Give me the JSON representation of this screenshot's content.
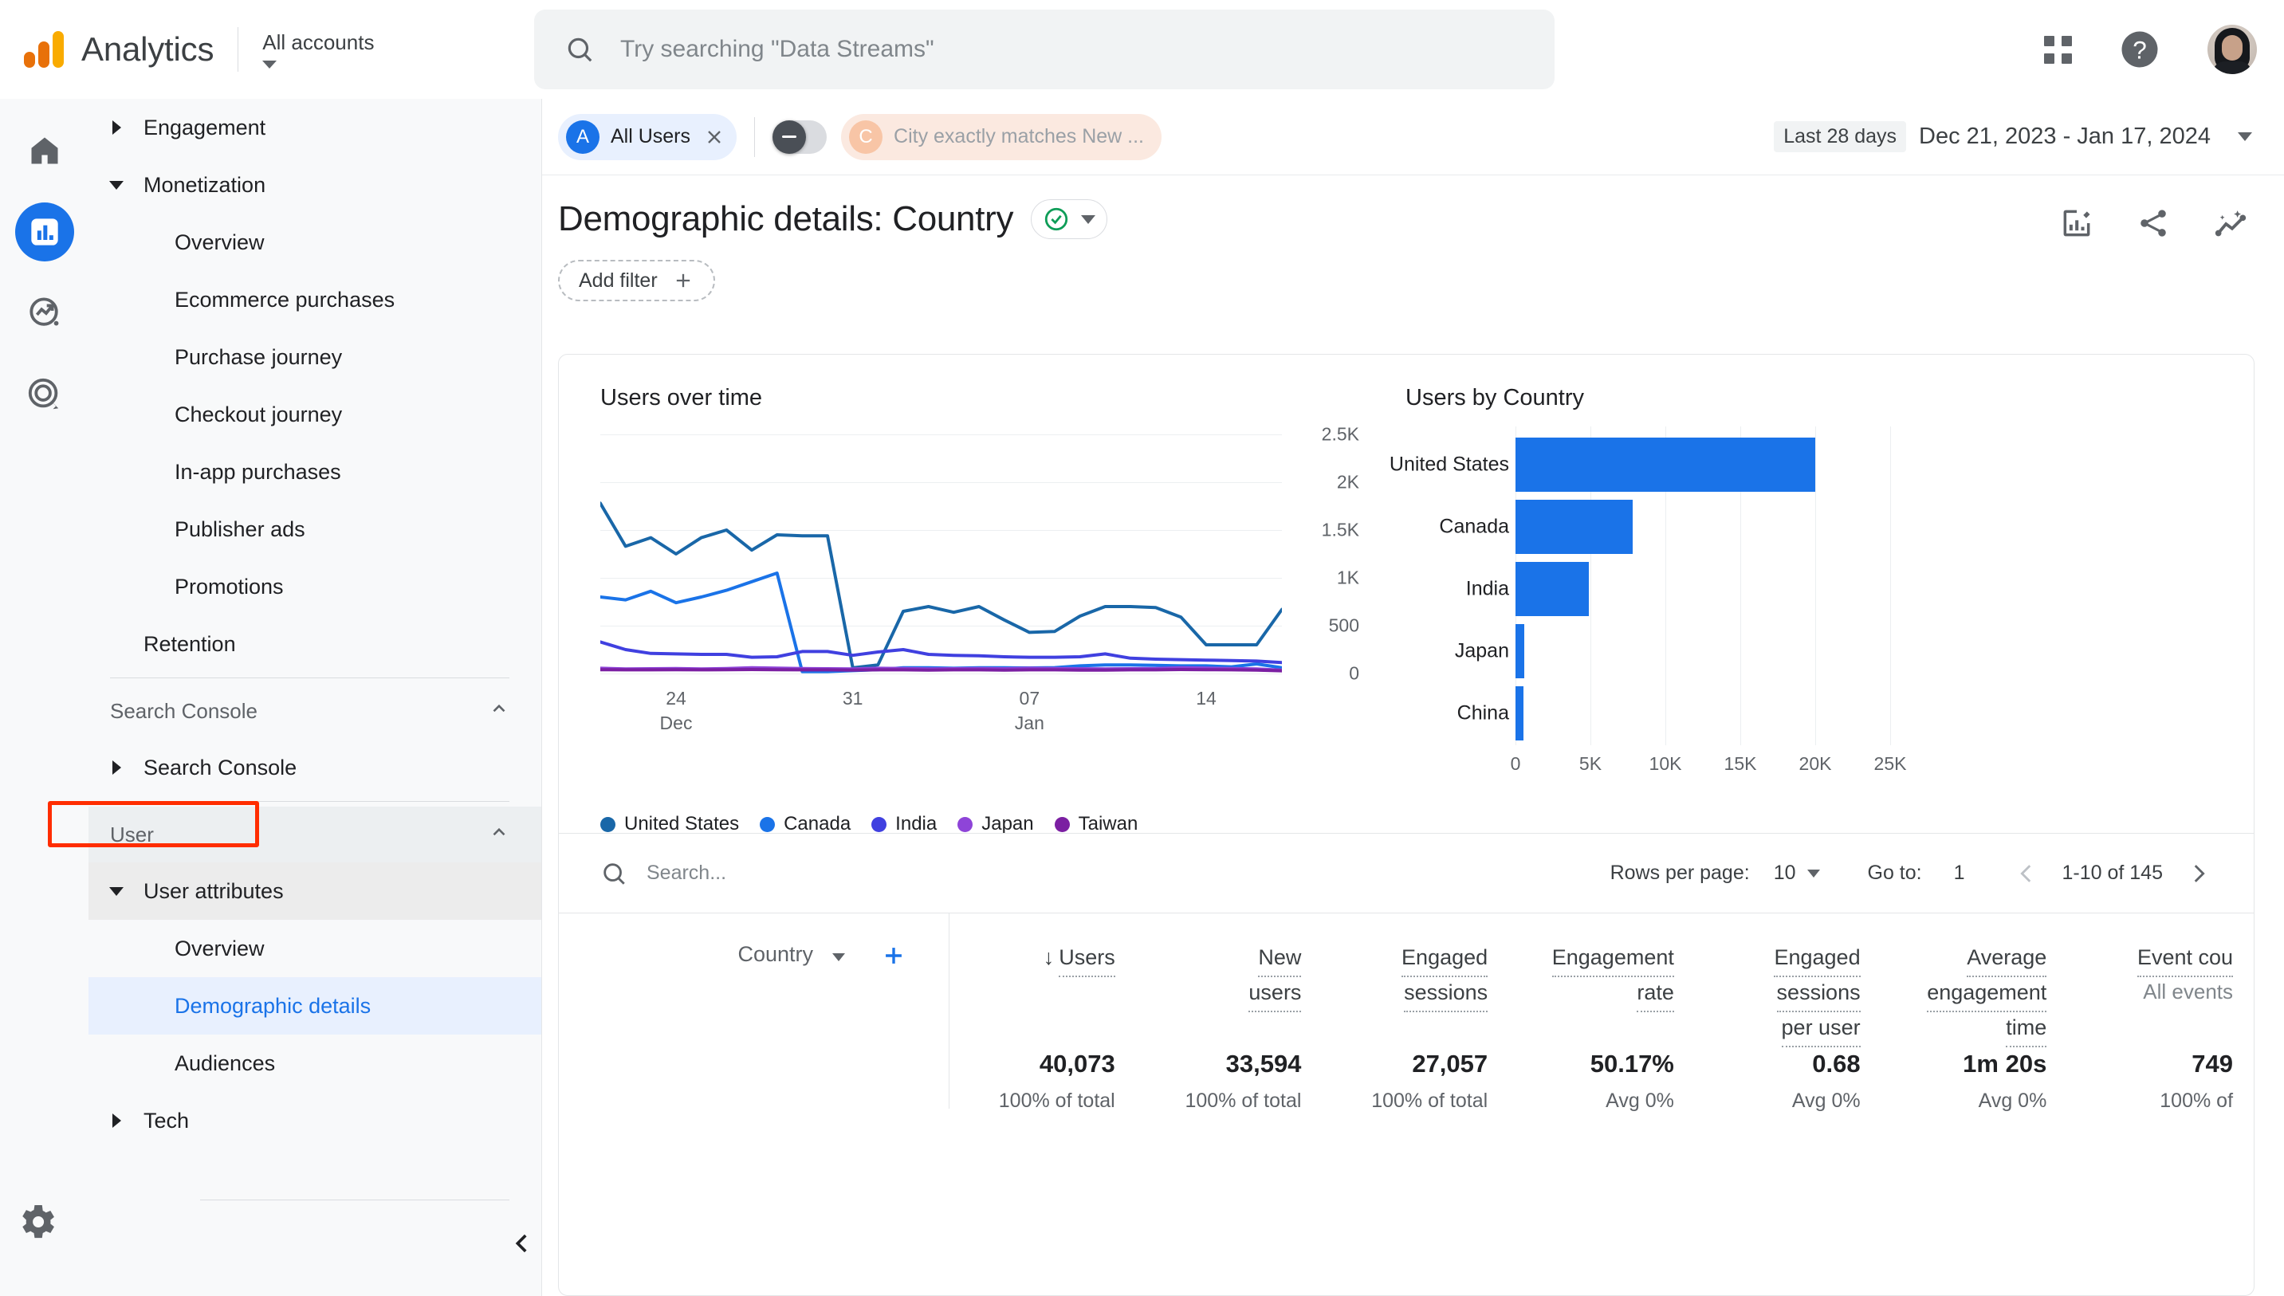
{
  "header": {
    "brand": "Analytics",
    "account_label": "All accounts",
    "search_placeholder": "Try searching \"Data Streams\"",
    "search_value": ""
  },
  "rail": {
    "items": [
      {
        "name": "home-icon",
        "label": "Home"
      },
      {
        "name": "reports-icon",
        "label": "Reports"
      },
      {
        "name": "explore-icon",
        "label": "Explore"
      },
      {
        "name": "advertising-icon",
        "label": "Advertising"
      }
    ],
    "settings_label": "Admin"
  },
  "sidebar": {
    "items": [
      {
        "label": "Engagement",
        "level": 1,
        "state": "collapsed"
      },
      {
        "label": "Monetization",
        "level": 1,
        "state": "expanded"
      },
      {
        "label": "Overview",
        "level": 2,
        "state": "leaf"
      },
      {
        "label": "Ecommerce purchases",
        "level": 2,
        "state": "leaf"
      },
      {
        "label": "Purchase journey",
        "level": 2,
        "state": "leaf"
      },
      {
        "label": "Checkout journey",
        "level": 2,
        "state": "leaf"
      },
      {
        "label": "In-app purchases",
        "level": 2,
        "state": "leaf"
      },
      {
        "label": "Publisher ads",
        "level": 2,
        "state": "leaf"
      },
      {
        "label": "Promotions",
        "level": 2,
        "state": "leaf"
      },
      {
        "label": "Retention",
        "level": 1,
        "state": "leaf"
      }
    ],
    "section_search_console": "Search Console",
    "item_search_console": "Search Console",
    "section_user": "User",
    "item_user_attributes": "User attributes",
    "item_overview": "Overview",
    "item_demographic_details": "Demographic details",
    "item_audiences": "Audiences",
    "item_tech": "Tech"
  },
  "filterbar": {
    "segment_initial": "A",
    "segment_label": "All Users",
    "comparison_initial": "C",
    "comparison_label": "City exactly matches New ...",
    "date_preset": "Last 28 days",
    "date_range": "Dec 21, 2023 - Jan 17, 2024"
  },
  "page": {
    "title": "Demographic details: Country",
    "add_filter_label": "Add filter",
    "icons": [
      "edit-chart-icon",
      "share-icon",
      "insights-icon"
    ]
  },
  "chart_data": [
    {
      "type": "line",
      "title": "Users over time",
      "xlabel": "",
      "ylabel": "",
      "ylim": [
        0,
        2500
      ],
      "yticks": [
        0,
        500,
        1000,
        1500,
        2000,
        2500
      ],
      "ytick_labels": [
        "0",
        "500",
        "1K",
        "1.5K",
        "2K",
        "2.5K"
      ],
      "grid": true,
      "legend_position": "bottom",
      "x": [
        "Dec 21",
        "Dec 22",
        "Dec 23",
        "Dec 24",
        "Dec 25",
        "Dec 26",
        "Dec 27",
        "Dec 28",
        "Dec 29",
        "Dec 30",
        "Dec 31",
        "Jan 01",
        "Jan 02",
        "Jan 03",
        "Jan 04",
        "Jan 05",
        "Jan 06",
        "Jan 07",
        "Jan 08",
        "Jan 09",
        "Jan 10",
        "Jan 11",
        "Jan 12",
        "Jan 13",
        "Jan 14",
        "Jan 15",
        "Jan 16",
        "Jan 17"
      ],
      "xtick_labels": [
        {
          "pos": 3,
          "top": "24",
          "bottom": "Dec"
        },
        {
          "pos": 10,
          "top": "31",
          "bottom": ""
        },
        {
          "pos": 17,
          "top": "07",
          "bottom": "Jan"
        },
        {
          "pos": 24,
          "top": "14",
          "bottom": ""
        }
      ],
      "series": [
        {
          "name": "United States",
          "color": "#1967a8",
          "values": [
            1780,
            1330,
            1420,
            1250,
            1420,
            1500,
            1290,
            1450,
            1440,
            1440,
            60,
            90,
            650,
            700,
            640,
            700,
            560,
            430,
            440,
            600,
            700,
            700,
            690,
            590,
            300,
            300,
            300,
            670
          ]
        },
        {
          "name": "Canada",
          "color": "#1a73e8",
          "values": [
            800,
            770,
            860,
            740,
            800,
            870,
            960,
            1050,
            20,
            20,
            30,
            40,
            60,
            60,
            55,
            60,
            60,
            58,
            62,
            80,
            90,
            90,
            85,
            80,
            80,
            70,
            100,
            60
          ]
        },
        {
          "name": "India",
          "color": "#4040e0",
          "values": [
            330,
            250,
            210,
            205,
            200,
            200,
            170,
            175,
            230,
            230,
            190,
            225,
            250,
            200,
            190,
            185,
            175,
            170,
            170,
            175,
            205,
            160,
            150,
            145,
            140,
            135,
            130,
            115
          ]
        },
        {
          "name": "Japan",
          "color": "#8e44d8",
          "values": [
            55,
            48,
            50,
            52,
            48,
            52,
            60,
            56,
            52,
            50,
            48,
            55,
            52,
            48,
            50,
            52,
            50,
            55,
            52,
            50,
            48,
            50,
            52,
            60,
            56,
            52,
            48,
            35
          ]
        },
        {
          "name": "Taiwan",
          "color": "#7b1fa2",
          "values": [
            40,
            38,
            38,
            40,
            38,
            40,
            42,
            40,
            38,
            38,
            35,
            38,
            38,
            36,
            38,
            38,
            36,
            38,
            38,
            36,
            36,
            38,
            38,
            42,
            40,
            38,
            36,
            28
          ]
        }
      ]
    },
    {
      "type": "bar",
      "orientation": "horizontal",
      "title": "Users by Country",
      "categories": [
        "United States",
        "Canada",
        "India",
        "Japan",
        "China"
      ],
      "values": [
        20000,
        7800,
        4900,
        600,
        520
      ],
      "xlim": [
        0,
        25000
      ],
      "xticks": [
        0,
        5000,
        10000,
        15000,
        20000,
        25000
      ],
      "xtick_labels": [
        "0",
        "5K",
        "10K",
        "15K",
        "20K",
        "25K"
      ],
      "bar_color": "#1a73e8",
      "grid": true
    }
  ],
  "table": {
    "search_placeholder": "Search...",
    "rows_per_page_label": "Rows per page:",
    "rows_per_page_value": "10",
    "goto_label": "Go to:",
    "goto_value": "1",
    "range_label": "1-10 of 145",
    "dimension_header": "Country",
    "add_dimension_label": "+",
    "columns": [
      {
        "label_lines": [
          "Users"
        ],
        "sorted": true,
        "sub": ""
      },
      {
        "label_lines": [
          "New",
          "users"
        ],
        "sorted": false,
        "sub": ""
      },
      {
        "label_lines": [
          "Engaged",
          "sessions"
        ],
        "sorted": false,
        "sub": ""
      },
      {
        "label_lines": [
          "Engagement",
          "rate"
        ],
        "sorted": false,
        "sub": ""
      },
      {
        "label_lines": [
          "Engaged",
          "sessions",
          "per user"
        ],
        "sorted": false,
        "sub": ""
      },
      {
        "label_lines": [
          "Average",
          "engagement",
          "time"
        ],
        "sorted": false,
        "sub": ""
      },
      {
        "label_lines": [
          "Event cou"
        ],
        "sorted": false,
        "sub": "All events"
      }
    ],
    "totals": [
      {
        "value": "40,073",
        "sub": "100% of total"
      },
      {
        "value": "33,594",
        "sub": "100% of total"
      },
      {
        "value": "27,057",
        "sub": "100% of total"
      },
      {
        "value": "50.17%",
        "sub": "Avg 0%"
      },
      {
        "value": "0.68",
        "sub": "Avg 0%"
      },
      {
        "value": "1m 20s",
        "sub": "Avg 0%"
      },
      {
        "value": "749",
        "sub": "100% of"
      }
    ]
  }
}
